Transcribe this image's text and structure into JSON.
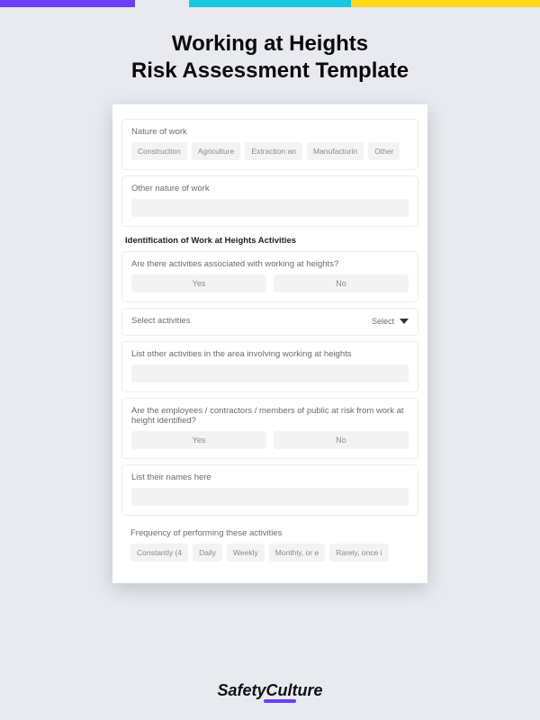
{
  "title_line1": "Working at Heights",
  "title_line2": "Risk Assessment Template",
  "brand": "SafetyCulture",
  "section_heading": "Identification of Work at Heights Activities",
  "nature_of_work": {
    "label": "Nature of work",
    "options": [
      "Construction",
      "Agriculture",
      "Extraction an",
      "Manufacturin",
      "Other"
    ]
  },
  "other_nature": {
    "label": "Other nature of work"
  },
  "activities_assoc": {
    "label": "Are there activities associated with working at heights?",
    "yes": "Yes",
    "no": "No"
  },
  "select_activities": {
    "label": "Select activities",
    "button": "Select"
  },
  "list_other": {
    "label": "List other activities in the area involving working at heights"
  },
  "at_risk": {
    "label": "Are the employees / contractors / members of public at risk from work at height identified?",
    "yes": "Yes",
    "no": "No"
  },
  "list_names": {
    "label": "List their names here"
  },
  "frequency": {
    "label": "Frequency of performing these activities",
    "options": [
      "Constantly (4",
      "Daily",
      "Weekly",
      "Monthly, or e",
      "Rarely, once i"
    ]
  }
}
